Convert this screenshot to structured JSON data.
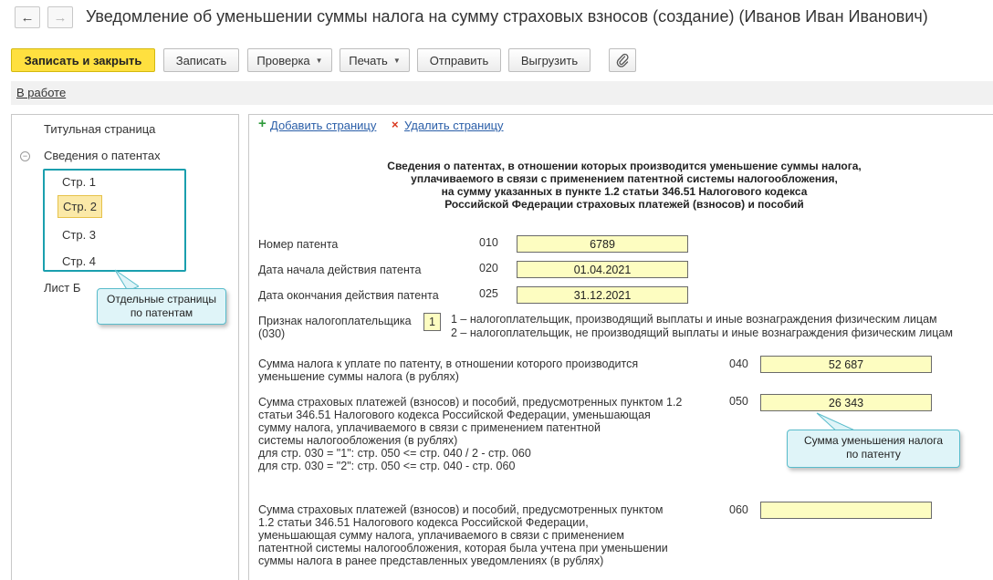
{
  "window": {
    "back_icon": "arrow-left-icon",
    "forward_icon": "arrow-right-icon",
    "title": "Уведомление об уменьшении суммы налога на сумму страховых взносов (создание) (Иванов Иван Иванович)"
  },
  "toolbar": {
    "save_close": "Записать и закрыть",
    "save": "Записать",
    "check": "Проверка",
    "print": "Печать",
    "send": "Отправить",
    "upload": "Выгрузить",
    "attach_icon": "paperclip-icon"
  },
  "status": {
    "label": "В работе"
  },
  "sidebar": {
    "title_page": "Титульная страница",
    "patents": "Сведения о патентах",
    "pages": [
      "Стр. 1",
      "Стр. 2",
      "Стр. 3",
      "Стр. 4"
    ],
    "selected_page": "Стр. 2",
    "sheet_b": "Лист Б"
  },
  "callouts": {
    "pages": "Отдельные  страницы\nпо патентам",
    "reduction": "Сумма уменьшения налога\nпо патенту"
  },
  "actions": {
    "add_page": "Добавить страницу",
    "delete_page": "Удалить страницу"
  },
  "form": {
    "heading": "Сведения о патентах, в отношении которых производится уменьшение суммы налога,\nуплачиваемого в связи с применением патентной системы налогообложения,\nна сумму указанных в пункте 1.2 статьи 346.51 Налогового кодекса\nРоссийской Федерации страховых платежей (взносов) и пособий",
    "patent_number": {
      "label": "Номер патента",
      "code": "010",
      "value": "6789"
    },
    "start_date": {
      "label": "Дата начала действия патента",
      "code": "020",
      "value": "01.04.2021"
    },
    "end_date": {
      "label": "Дата окончания действия патента",
      "code": "025",
      "value": "31.12.2021"
    },
    "taxpayer_sign": {
      "label": "Признак налогоплательщика\n(030)",
      "value": "1",
      "option1": "1 – налогоплательщик, производящий выплаты и иные вознаграждения физическим лицам",
      "option2": "2 – налогоплательщик, не производящий выплаты и иные вознаграждения физическим лицам"
    },
    "line040": {
      "label": "Сумма налога к уплате по патенту, в отношении которого производится\nуменьшение суммы налога (в рублях)",
      "code": "040",
      "value": "52 687"
    },
    "line050": {
      "label": "Сумма страховых платежей (взносов) и пособий, предусмотренных пунктом 1.2\nстатьи 346.51 Налогового кодекса Российской Федерации, уменьшающая\nсумму налога, уплачиваемого в связи с применением патентной\nсистемы налогообложения (в рублях)\nдля стр. 030 = \"1\": стр. 050 <= стр. 040 / 2 - стр. 060\nдля стр. 030 = \"2\": стр. 050 <= стр. 040 - стр. 060",
      "code": "050",
      "value": "26 343"
    },
    "line060": {
      "label": "Сумма страховых платежей (взносов) и пособий, предусмотренных пунктом\n1.2 статьи 346.51 Налогового кодекса Российской Федерации,\nуменьшающая сумму налога, уплачиваемого в связи с применением\nпатентной системы налогообложения, которая была учтена при уменьшении\nсуммы налога в ранее представленных уведомлениях (в рублях)",
      "code": "060",
      "value": ""
    }
  }
}
